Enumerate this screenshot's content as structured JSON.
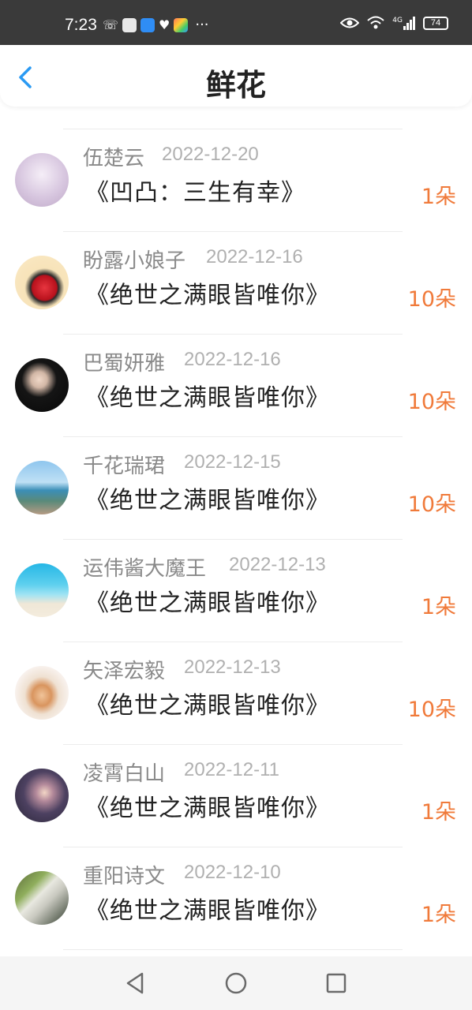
{
  "status_bar": {
    "time": "7:23",
    "more": "···",
    "battery": "74",
    "network": "4G"
  },
  "header": {
    "title": "鲜花"
  },
  "colors": {
    "accent": "#2a9af3",
    "count": "#f07a3a"
  },
  "flowers": [
    {
      "name": "伍楚云",
      "date": "2022-12-20",
      "book": "《凹凸：三生有幸》",
      "count": "1朵"
    },
    {
      "name": "盼露小娘子",
      "date": "2022-12-16",
      "book": "《绝世之满眼皆唯你》",
      "count": "10朵"
    },
    {
      "name": "巴蜀妍雅",
      "date": "2022-12-16",
      "book": "《绝世之满眼皆唯你》",
      "count": "10朵"
    },
    {
      "name": "千花瑞珺",
      "date": "2022-12-15",
      "book": "《绝世之满眼皆唯你》",
      "count": "10朵"
    },
    {
      "name": "运伟酱大魔王",
      "date": "2022-12-13",
      "book": "《绝世之满眼皆唯你》",
      "count": "1朵"
    },
    {
      "name": "矢泽宏毅",
      "date": "2022-12-13",
      "book": "《绝世之满眼皆唯你》",
      "count": "10朵"
    },
    {
      "name": "凌霄白山",
      "date": "2022-12-11",
      "book": "《绝世之满眼皆唯你》",
      "count": "1朵"
    },
    {
      "name": "重阳诗文",
      "date": "2022-12-10",
      "book": "《绝世之满眼皆唯你》",
      "count": "1朵"
    }
  ],
  "nav": {
    "back": "back-triangle-icon",
    "home": "home-circle-icon",
    "recents": "recents-square-icon"
  }
}
